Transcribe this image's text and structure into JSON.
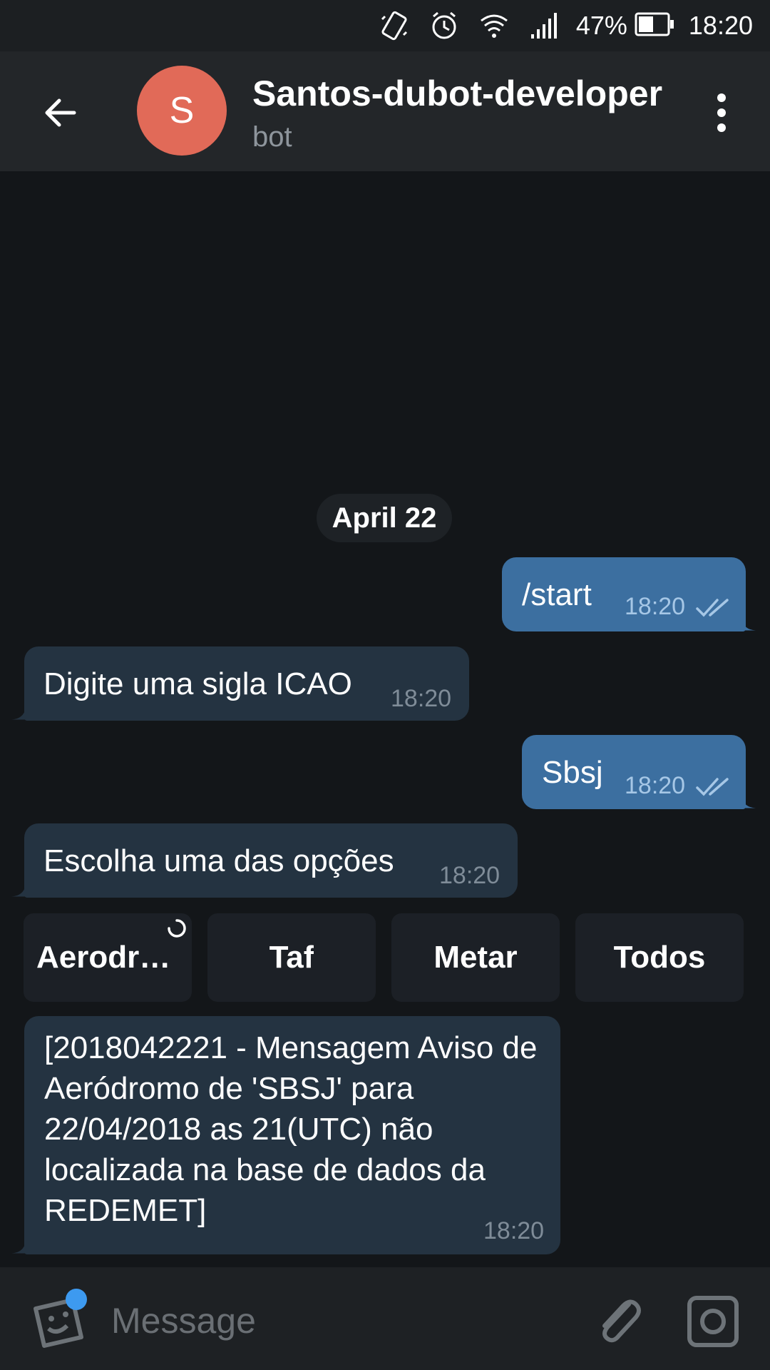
{
  "status_bar": {
    "battery_percent": "47%",
    "time": "18:20",
    "icons": [
      "vibrate-icon",
      "alarm-icon",
      "wifi-icon",
      "signal-icon",
      "battery-icon"
    ]
  },
  "header": {
    "avatar_letter": "S",
    "avatar_color": "#e16a58",
    "title": "Santos-dubot-developer",
    "subtitle": "bot"
  },
  "chat": {
    "date_label": "April 22",
    "messages": [
      {
        "direction": "out",
        "text": "/start",
        "time": "18:20",
        "read": true
      },
      {
        "direction": "in",
        "text": "Digite uma sigla ICAO",
        "time": "18:20"
      },
      {
        "direction": "out",
        "text": "Sbsj",
        "time": "18:20",
        "read": true
      },
      {
        "direction": "in",
        "text": "Escolha uma das opções",
        "time": "18:20"
      },
      {
        "direction": "in",
        "text": "[2018042221 - Mensagem Aviso de Aeródromo de 'SBSJ' para 22/04/2018 as 21(UTC) não localizada na base de dados da REDEMET]",
        "time": "18:20"
      }
    ],
    "keyboard_buttons": [
      {
        "label": "Aerodromo",
        "loading": true
      },
      {
        "label": "Taf"
      },
      {
        "label": "Metar"
      },
      {
        "label": "Todos"
      }
    ]
  },
  "input_bar": {
    "placeholder": "Message"
  },
  "colors": {
    "background": "#131619",
    "header": "#232629",
    "bubble_out": "#3c6fa0",
    "bubble_in": "#243341",
    "accent_dot": "#3d9af0"
  }
}
